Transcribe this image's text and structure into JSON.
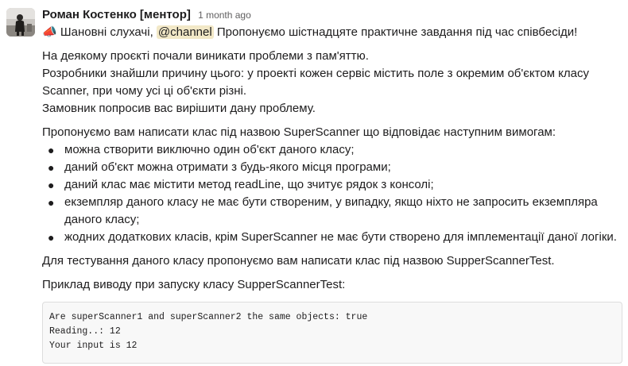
{
  "message": {
    "author": "Роман Костенко [ментор]",
    "timestamp": "1 month ago",
    "avatar_icon": "user-avatar-photo",
    "intro": {
      "emoji": "📣",
      "before_mention": "Шановні слухачі,",
      "mention": "@channel",
      "after_mention": "Пропонуємо шістнадцяте практичне завдання під час співбесіди!"
    },
    "problem_lines": [
      "На деякому проєкті почали виникати проблеми з пам'яттю.",
      "Розробники знайшли причину цього: у проекті кожен сервіс містить поле з окремим об'єктом класу",
      "Scanner, при чому усі ці об'єкти різні.",
      "Замовник попросив вас вирішити дану проблему."
    ],
    "requirements_intro": "Пропонуємо вам написати клас під назвою SuperScanner що відповідає наступним вимогам:",
    "requirements": [
      "можна створити виключно один об'єкт даного класу;",
      "даний об'єкт можна отримати з будь-якого місця програми;",
      "даний клас має містити метод readLine, що зчитує рядок з консолі;",
      "екземпляр даного класу не має бути створеним, у випадку, якщо ніхто не запросить екземпляра даного класу;",
      "жодних додаткових класів, крім SuperScanner не має бути створено для імплементації даної логіки."
    ],
    "testing_text": "Для тестування даного класу пропонуємо вам написати клас під назвою SupperScannerTest.",
    "example_text": "Приклад виводу при запуску класу SupperScannerTest:",
    "code_lines": [
      "Are superScanner1 and superScanner2 the same objects: true",
      "Reading..: 12",
      "Your input is 12"
    ]
  },
  "colors": {
    "mention_bg": "#f2e8c7",
    "mention_text": "#1264a3",
    "text": "#1d1c1d",
    "muted": "#616061",
    "code_bg": "#f8f8f8",
    "code_border": "#dddddd"
  }
}
